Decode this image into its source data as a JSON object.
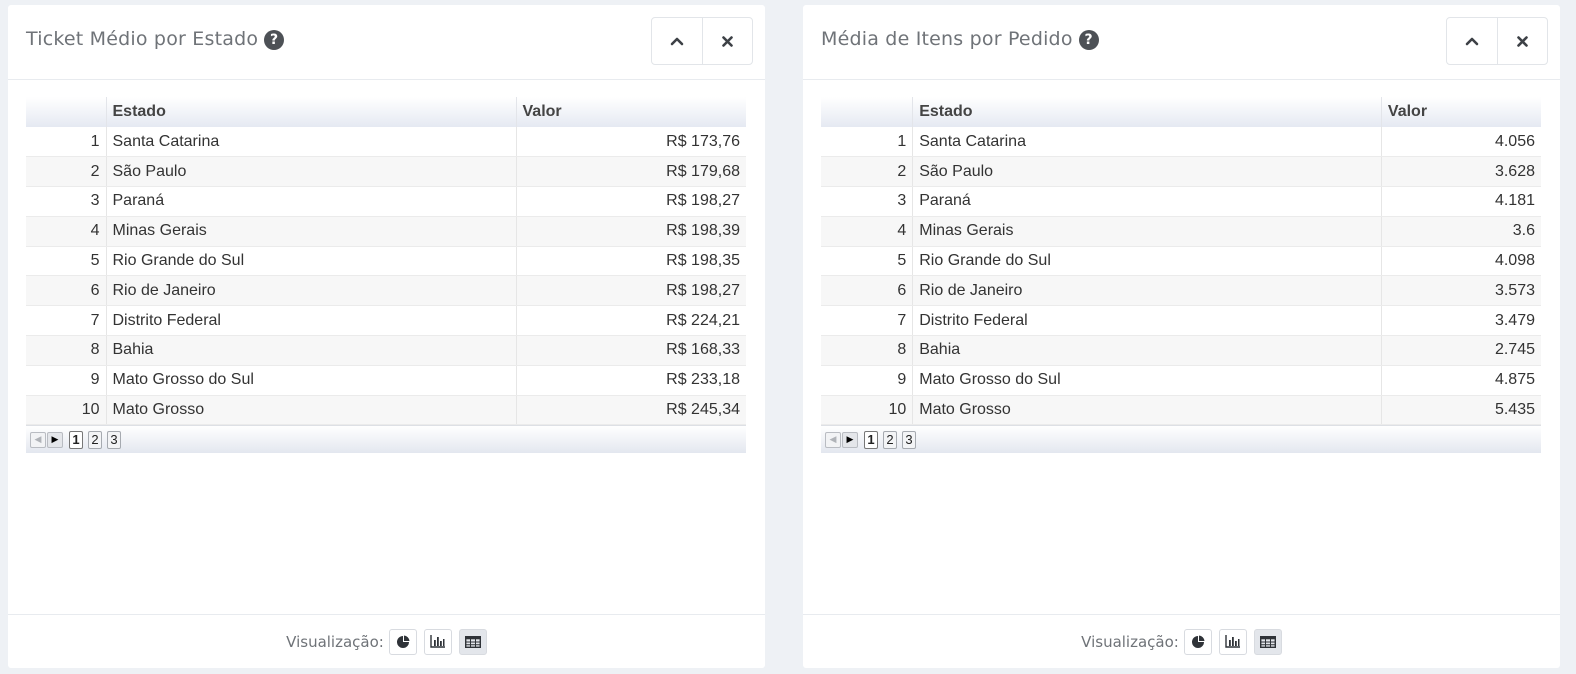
{
  "panels": [
    {
      "title": "Ticket Médio por Estado",
      "columns": [
        "",
        "Estado",
        "Valor"
      ],
      "rows": [
        {
          "idx": "1",
          "estado": "Santa Catarina",
          "valor": "R$ 173,76"
        },
        {
          "idx": "2",
          "estado": "São Paulo",
          "valor": "R$ 179,68"
        },
        {
          "idx": "3",
          "estado": "Paraná",
          "valor": "R$ 198,27"
        },
        {
          "idx": "4",
          "estado": "Minas Gerais",
          "valor": "R$ 198,39"
        },
        {
          "idx": "5",
          "estado": "Rio Grande do Sul",
          "valor": "R$ 198,35"
        },
        {
          "idx": "6",
          "estado": "Rio de Janeiro",
          "valor": "R$ 198,27"
        },
        {
          "idx": "7",
          "estado": "Distrito Federal",
          "valor": "R$ 224,21"
        },
        {
          "idx": "8",
          "estado": "Bahia",
          "valor": "R$ 168,33"
        },
        {
          "idx": "9",
          "estado": "Mato Grosso do Sul",
          "valor": "R$ 233,18"
        },
        {
          "idx": "10",
          "estado": "Mato Grosso",
          "valor": "R$ 245,34"
        }
      ],
      "pager": {
        "pages": [
          "1",
          "2",
          "3"
        ],
        "current": "1",
        "prev_icon": "triangle-left-icon",
        "next_icon": "triangle-right-icon"
      },
      "footer_label": "Visualização:",
      "viz_buttons": [
        {
          "icon": "pie-chart-icon",
          "active": false
        },
        {
          "icon": "bar-chart-icon",
          "active": false
        },
        {
          "icon": "table-icon",
          "active": true
        }
      ]
    },
    {
      "title": "Média de Itens por Pedido",
      "columns": [
        "",
        "Estado",
        "Valor"
      ],
      "rows": [
        {
          "idx": "1",
          "estado": "Santa Catarina",
          "valor": "4.056"
        },
        {
          "idx": "2",
          "estado": "São Paulo",
          "valor": "3.628"
        },
        {
          "idx": "3",
          "estado": "Paraná",
          "valor": "4.181"
        },
        {
          "idx": "4",
          "estado": "Minas Gerais",
          "valor": "3.6"
        },
        {
          "idx": "5",
          "estado": "Rio Grande do Sul",
          "valor": "4.098"
        },
        {
          "idx": "6",
          "estado": "Rio de Janeiro",
          "valor": "3.573"
        },
        {
          "idx": "7",
          "estado": "Distrito Federal",
          "valor": "3.479"
        },
        {
          "idx": "8",
          "estado": "Bahia",
          "valor": "2.745"
        },
        {
          "idx": "9",
          "estado": "Mato Grosso do Sul",
          "valor": "4.875"
        },
        {
          "idx": "10",
          "estado": "Mato Grosso",
          "valor": "5.435"
        }
      ],
      "pager": {
        "pages": [
          "1",
          "2",
          "3"
        ],
        "current": "1",
        "prev_icon": "triangle-left-icon",
        "next_icon": "triangle-right-icon"
      },
      "footer_label": "Visualização:",
      "viz_buttons": [
        {
          "icon": "pie-chart-icon",
          "active": false
        },
        {
          "icon": "bar-chart-icon",
          "active": false
        },
        {
          "icon": "table-icon",
          "active": true
        }
      ]
    }
  ],
  "header_icons": [
    "chevron-up-icon",
    "close-icon",
    "question-circle-icon"
  ],
  "colors": {
    "page_bg": "#eef1f5",
    "panel_bg": "#ffffff",
    "title": "#6f7378",
    "header_grad_end": "#e5e9f2"
  }
}
